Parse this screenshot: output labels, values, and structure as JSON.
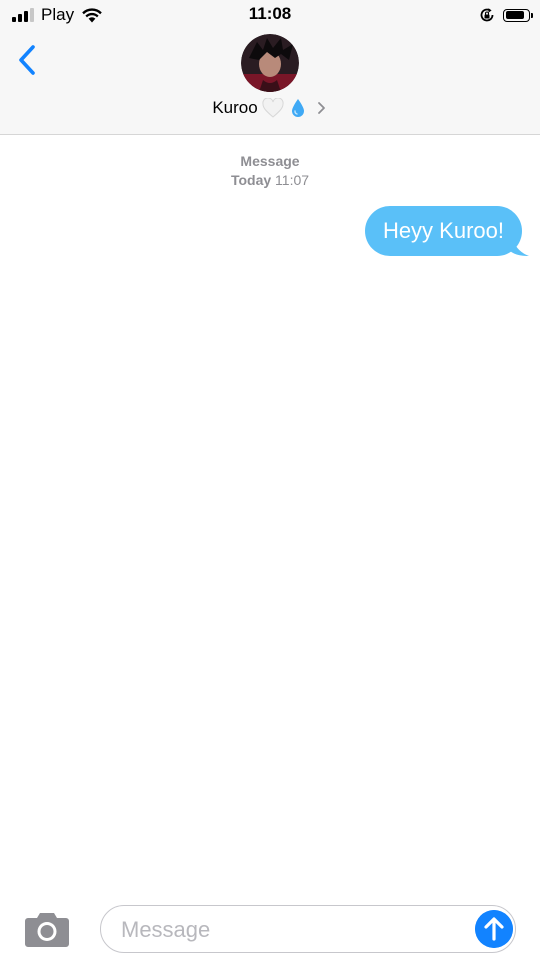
{
  "status_bar": {
    "carrier": "Play",
    "time": "11:08",
    "battery_level": 0.85,
    "signal_bars": 3,
    "signal_total": 4
  },
  "header": {
    "contact_name": "Kuroo",
    "emoji_heart": "white-heart-icon",
    "emoji_drop": "droplet-icon"
  },
  "conversation": {
    "service_label": "Message",
    "day_label": "Today",
    "time_label": "11:07",
    "messages": [
      {
        "text": "Heyy Kuroo!",
        "direction": "sent"
      }
    ]
  },
  "composer": {
    "placeholder": "Message"
  },
  "colors": {
    "accent": "#1283ff",
    "sent_bubble": "#5ac0f8",
    "meta_text": "#8e8e93",
    "bar_bg": "#f7f7f7"
  }
}
